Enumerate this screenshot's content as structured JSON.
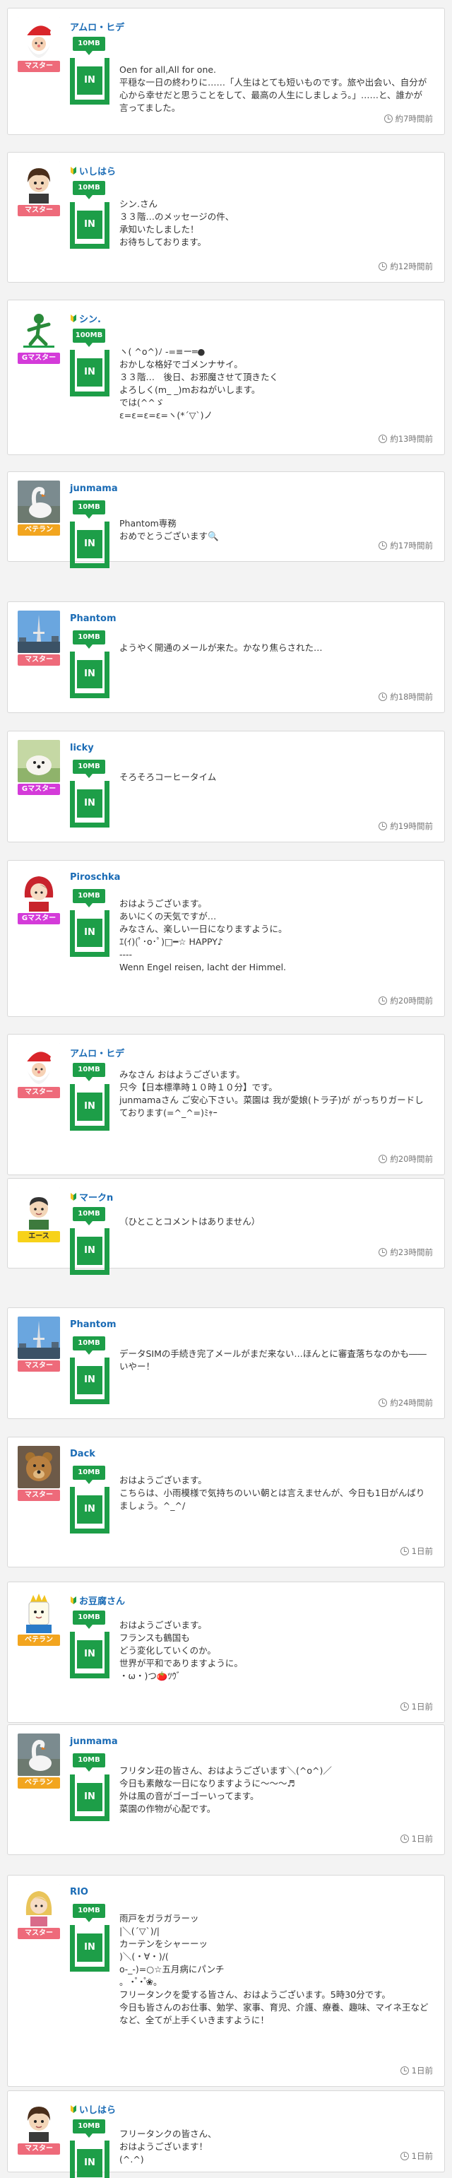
{
  "colors": {
    "rank_master": "#ee6a7a",
    "rank_gmaster": "#d43bd9",
    "rank_veteran": "#f2a51f",
    "rank_ace": "#f7d21a",
    "accent_green": "#1d9e48",
    "name_blue": "#1a6bb5"
  },
  "in_label": "IN",
  "posts": [
    {
      "name": "アムロ・ヒデ",
      "leaf": false,
      "rank": "マスター",
      "rank_color": "#ee6a7a",
      "mb": "10MB",
      "avatar": "santa",
      "time": "約7時間前",
      "message": "Oen for all,All for one.\n平穏な一日の終わりに……「人生はとても短いものです。旅や出会い、自分が心から幸せだと思うことをして、最高の人生にしましょう。」……と、誰かが言ってました。"
    },
    {
      "name": "いしはら",
      "leaf": true,
      "rank": "マスター",
      "rank_color": "#ee6a7a",
      "mb": "10MB",
      "avatar": "boy",
      "time": "約12時間前",
      "message": "シン.さん\n３３階…のメッセージの件、\n承知いたしました！\nお待ちしております。"
    },
    {
      "name": "シン.",
      "leaf": true,
      "rank": "Gマスター",
      "rank_color": "#d43bd9",
      "mb": "100MB",
      "avatar": "runner",
      "time": "約13時間前",
      "message": "ヽ( ^o^)ﾉ ‐=≡ー═●\nおかしな格好でゴメンナサイ。\n３３階…　後日、お邪魔させて頂きたく\nよろしく(m_ _)mおねがいします。\nでは(^^ゞ\nε=ε=ε=ε=ヽ(*´▽`)ノ"
    },
    {
      "name": "junmama",
      "leaf": false,
      "rank": "ベテラン",
      "rank_color": "#f2a51f",
      "mb": "10MB",
      "avatar": "swan",
      "time": "約17時間前",
      "message": "Phantom専務\nおめでとうございます🔍"
    },
    {
      "name": "Phantom",
      "leaf": false,
      "rank": "マスター",
      "rank_color": "#ee6a7a",
      "mb": "10MB",
      "avatar": "tower",
      "time": "約18時間前",
      "message": "ようやく開通のメールが来た。かなり焦らされた…"
    },
    {
      "name": "licky",
      "leaf": false,
      "rank": "Gマスター",
      "rank_color": "#d43bd9",
      "mb": "10MB",
      "avatar": "dog",
      "time": "約19時間前",
      "message": "そろそろコーヒータイム"
    },
    {
      "name": "Piroschka",
      "leaf": false,
      "rank": "Gマスター",
      "rank_color": "#d43bd9",
      "mb": "10MB",
      "avatar": "girl",
      "time": "約20時間前",
      "message": "おはようございます。\nあいにくの天気ですが…\nみなさん、楽しい一日になりますように。\nｴ(ｲ)(ﾟ･o･ﾟ)□━☆ HAPPY♪\n----\nWenn Engel reisen, lacht der Himmel."
    },
    {
      "name": "アムロ・ヒデ",
      "leaf": false,
      "rank": "マスター",
      "rank_color": "#ee6a7a",
      "mb": "10MB",
      "avatar": "santa",
      "time": "約20時間前",
      "message": "みなさん おはようございます。\n只今【日本標準時１０時１０分】です。\njunmamaさん ご安心下さい。菜園は 我が愛娘(トラ子)が がっちりガードしております(=^_^=)ﾐｬｰ"
    },
    {
      "name": "マークn",
      "leaf": true,
      "rank": "エース",
      "rank_color": "#f7d21a",
      "mb": "10MB",
      "avatar": "man",
      "time": "約23時間前",
      "message": "（ひとことコメントはありません）"
    },
    {
      "name": "Phantom",
      "leaf": false,
      "rank": "マスター",
      "rank_color": "#ee6a7a",
      "mb": "10MB",
      "avatar": "tower",
      "time": "約24時間前",
      "message": "データSIMの手続き完了メールがまだ来ない…ほんとに審査落ちなのかも――いやー！"
    },
    {
      "name": "Dack",
      "leaf": false,
      "rank": "マスター",
      "rank_color": "#ee6a7a",
      "mb": "10MB",
      "avatar": "bear",
      "time": "1日前",
      "message": "おはようございます。\nこちらは、小雨模様で気持ちのいい朝とは言えませんが、今日も1日がんばりましょう。^_^/"
    },
    {
      "name": "お豆腐さん",
      "leaf": true,
      "rank": "ベテラン",
      "rank_color": "#f2a51f",
      "mb": "10MB",
      "avatar": "king",
      "time": "1日前",
      "message": "おはようございます。\nフランスも鶴国も\nどう変化していくのか。\n世界が平和でありますように。\n・ω・)つ🍅ﾂｳﾞ"
    },
    {
      "name": "junmama",
      "leaf": false,
      "rank": "ベテラン",
      "rank_color": "#f2a51f",
      "mb": "10MB",
      "avatar": "swan",
      "time": "1日前",
      "message": "フリタン荘の皆さん、おはようございます＼(^o^)／\n今日も素敵な一日になりますように〜〜〜♬\n外は風の音がゴーゴーいってます。\n菜園の作物が心配です。"
    },
    {
      "name": "RIO",
      "leaf": false,
      "rank": "マスター",
      "rank_color": "#ee6a7a",
      "mb": "10MB",
      "avatar": "blonde",
      "time": "1日前",
      "message": "雨戸をガラガラーッ\n|＼(´▽`)/|\nカーテンをシャーーッ\n)＼(・∀・)/(\nο-_-)=○☆五月病にパンチ\n。•゚•゚❀。\nフリータンクを愛する皆さん、おはようございます。5時30分です。\n今日も皆さんのお仕事、勉学、家事、育児、介護、療養、趣味、マイネ王などなど、全てが上手くいきますように！"
    },
    {
      "name": "いしはら",
      "leaf": true,
      "rank": "マスター",
      "rank_color": "#ee6a7a",
      "mb": "10MB",
      "avatar": "boy",
      "time": "1日前",
      "message": "フリータンクの皆さん、\nおはようございます！\n(^.^)"
    }
  ]
}
